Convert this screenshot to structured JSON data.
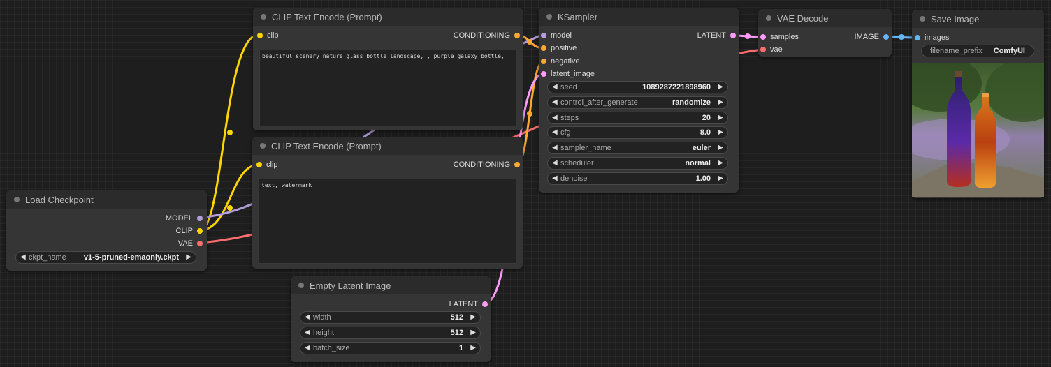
{
  "colors": {
    "model": "#b39ddb",
    "clip": "#ffd500",
    "vae": "#ff6e6e",
    "conditioning": "#ffa931",
    "latent": "#ff9cf9",
    "image": "#64b5f6"
  },
  "load_checkpoint": {
    "title": "Load Checkpoint",
    "outputs": {
      "model": "MODEL",
      "clip": "CLIP",
      "vae": "VAE"
    },
    "ckpt_name_label": "ckpt_name",
    "ckpt_name_value": "v1-5-pruned-emaonly.ckpt"
  },
  "clip_pos": {
    "title": "CLIP Text Encode (Prompt)",
    "input_clip": "clip",
    "output_conditioning": "CONDITIONING",
    "text": "beautiful scenery nature glass bottle landscape, , purple galaxy bottle,"
  },
  "clip_neg": {
    "title": "CLIP Text Encode (Prompt)",
    "input_clip": "clip",
    "output_conditioning": "CONDITIONING",
    "text": "text, watermark"
  },
  "empty_latent": {
    "title": "Empty Latent Image",
    "output": "LATENT",
    "widgets": [
      {
        "label": "width",
        "value": "512"
      },
      {
        "label": "height",
        "value": "512"
      },
      {
        "label": "batch_size",
        "value": "1"
      }
    ]
  },
  "ksampler": {
    "title": "KSampler",
    "inputs": {
      "model": "model",
      "positive": "positive",
      "negative": "negative",
      "latent_image": "latent_image"
    },
    "output": "LATENT",
    "widgets": [
      {
        "label": "seed",
        "value": "1089287221898960"
      },
      {
        "label": "control_after_generate",
        "value": "randomize"
      },
      {
        "label": "steps",
        "value": "20"
      },
      {
        "label": "cfg",
        "value": "8.0"
      },
      {
        "label": "sampler_name",
        "value": "euler"
      },
      {
        "label": "scheduler",
        "value": "normal"
      },
      {
        "label": "denoise",
        "value": "1.00"
      }
    ]
  },
  "vae_decode": {
    "title": "VAE Decode",
    "inputs": {
      "samples": "samples",
      "vae": "vae"
    },
    "output": "IMAGE"
  },
  "save_image": {
    "title": "Save Image",
    "input": "images",
    "filename_prefix_label": "filename_prefix",
    "filename_prefix_value": "ComfyUI"
  }
}
